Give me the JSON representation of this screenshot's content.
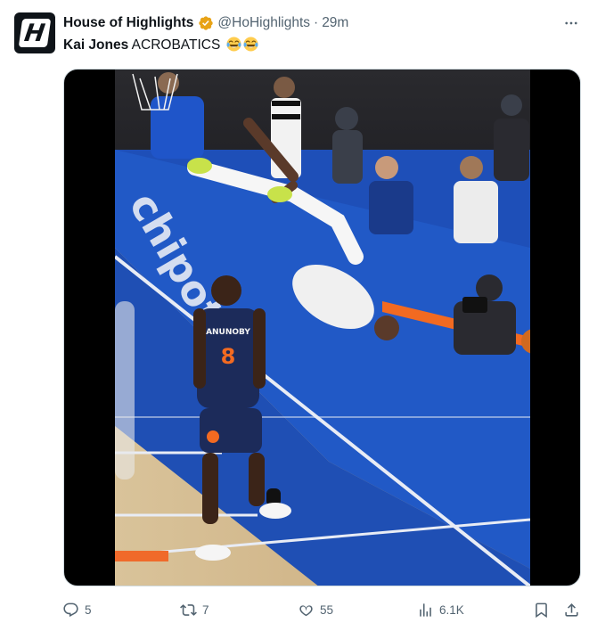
{
  "author": {
    "name": "House of Highlights",
    "handle": "@HoHighlights",
    "separator": "·",
    "time": "29m",
    "avatar_letter": "H",
    "verified": true,
    "verified_color": "#e8a317"
  },
  "tweet": {
    "bold_text": "Kai Jones",
    "text": " ACROBATICS",
    "emojis": [
      "tears-of-joy-emoji",
      "tears-of-joy-emoji"
    ]
  },
  "media": {
    "type": "video",
    "player_jersey_name": "ANUNOBY",
    "player_jersey_number": "8",
    "court_floor_text": "chipotle",
    "court_color": "#1e4fb8"
  },
  "actions": {
    "replies": "5",
    "reposts": "7",
    "likes": "55",
    "views": "6.1K"
  },
  "colors": {
    "text_primary": "#0f1419",
    "text_secondary": "#536471",
    "border": "#cfd9de"
  }
}
